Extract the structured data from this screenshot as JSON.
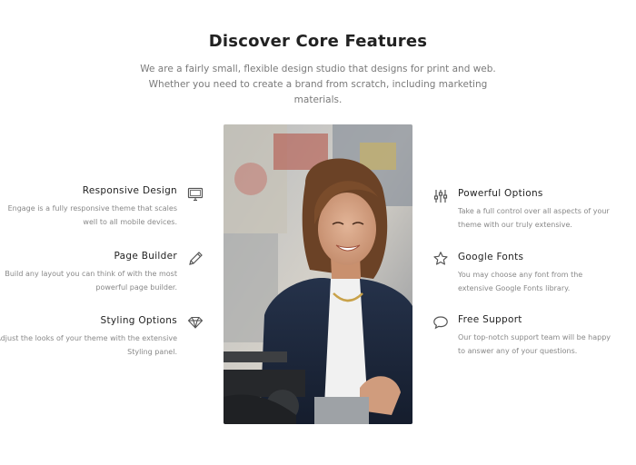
{
  "header": {
    "title": "Discover Core Features",
    "subtitle": "We are a fairly small, flexible design studio that designs for print and web. Whether you need to create a brand from scratch, including marketing materials."
  },
  "features_left": [
    {
      "icon": "monitor-icon",
      "title": "Responsive Design",
      "desc": "Engage is a fully responsive theme that scales well to all mobile devices."
    },
    {
      "icon": "pencil-icon",
      "title": "Page Builder",
      "desc": "Build any layout you can think of with the most powerful page builder."
    },
    {
      "icon": "diamond-icon",
      "title": "Styling Options",
      "desc": "Adjust the looks of your theme with the extensive Styling panel."
    }
  ],
  "features_right": [
    {
      "icon": "sliders-icon",
      "title": "Powerful Options",
      "desc": "Take a full control over all aspects of your theme with our truly extensive."
    },
    {
      "icon": "star-icon",
      "title": "Google Fonts",
      "desc": "You may choose any font from the extensive Google Fonts library."
    },
    {
      "icon": "speech-bubble-icon",
      "title": "Free Support",
      "desc": "Our top-notch support team will be happy to answer any of your questions."
    }
  ],
  "colors": {
    "text": "#222222",
    "muted": "#888888",
    "icon": "#555555"
  }
}
